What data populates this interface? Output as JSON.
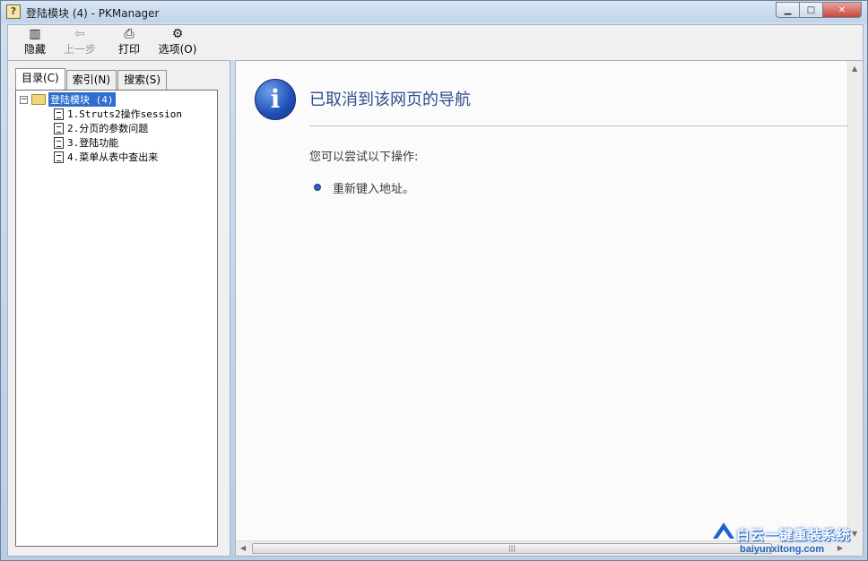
{
  "window": {
    "title": "登陆模块 (4) - PKManager",
    "icon": "help-file-icon"
  },
  "toolbar": {
    "buttons": [
      {
        "label": "隐藏",
        "icon": "hide-icon",
        "enabled": true
      },
      {
        "label": "上一步",
        "icon": "back-arrow-icon",
        "enabled": false
      },
      {
        "label": "打印",
        "icon": "printer-icon",
        "enabled": true
      },
      {
        "label": "选项(O)",
        "icon": "options-icon",
        "enabled": true
      }
    ]
  },
  "nav": {
    "tabs": [
      {
        "label": "目录(C)",
        "active": true
      },
      {
        "label": "索引(N)",
        "active": false
      },
      {
        "label": "搜索(S)",
        "active": false
      }
    ],
    "tree": {
      "root": {
        "label": "登陆模块 (4)",
        "expanded": true,
        "selected": true,
        "expander": "⊟"
      },
      "children": [
        {
          "label": "1.Struts2操作session"
        },
        {
          "label": "2.分页的参数问题"
        },
        {
          "label": "3.登陆功能"
        },
        {
          "label": "4.菜单从表中查出来"
        }
      ]
    }
  },
  "content": {
    "title": "已取消到该网页的导航",
    "subtitle": "您可以尝试以下操作:",
    "actions": [
      "重新键入地址。"
    ],
    "info_icon": "i"
  },
  "watermark": {
    "text": "白云一键重装系统",
    "url": "baiyunxitong.com"
  },
  "colors": {
    "accent": "#2c4e8f",
    "selection": "#2f6ecf"
  }
}
